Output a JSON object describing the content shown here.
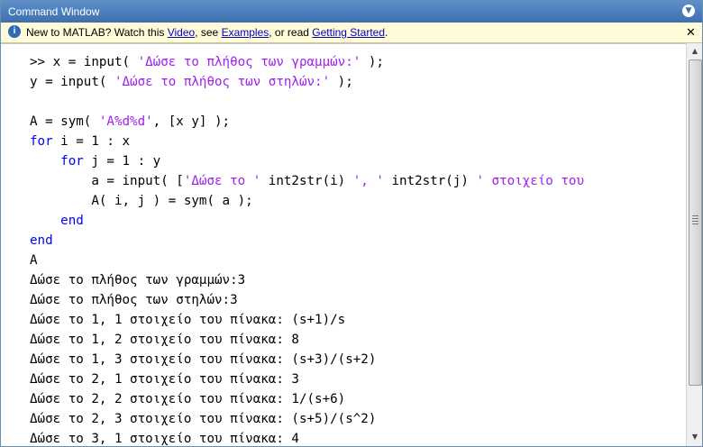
{
  "window": {
    "title": "Command Window",
    "menu_icon": "chevron-down-icon"
  },
  "infobar": {
    "prefix": "New to MATLAB? Watch this ",
    "video_link": "Video",
    "mid1": ", see ",
    "examples_link": "Examples",
    "mid2": ", or read ",
    "getting_started_link": "Getting Started",
    "suffix": ".",
    "close_label": "✕",
    "icon_label": "i"
  },
  "console": {
    "lines": [
      [
        {
          "t": ">> x = input( ",
          "c": "plain"
        },
        {
          "t": "'Δώσε το πλήθος των γραμμών:'",
          "c": "str"
        },
        {
          "t": " );",
          "c": "plain"
        }
      ],
      [
        {
          "t": "y = input( ",
          "c": "plain"
        },
        {
          "t": "'Δώσε το πλήθος των στηλών:'",
          "c": "str"
        },
        {
          "t": " );",
          "c": "plain"
        }
      ],
      [],
      [
        {
          "t": "A = sym( ",
          "c": "plain"
        },
        {
          "t": "'A%d%d'",
          "c": "str"
        },
        {
          "t": ", [x y] );",
          "c": "plain"
        }
      ],
      [
        {
          "t": "for",
          "c": "kw"
        },
        {
          "t": " i = 1 : x",
          "c": "plain"
        }
      ],
      [
        {
          "t": "    ",
          "c": "plain"
        },
        {
          "t": "for",
          "c": "kw"
        },
        {
          "t": " j = 1 : y",
          "c": "plain"
        }
      ],
      [
        {
          "t": "        a = input( [",
          "c": "plain"
        },
        {
          "t": "'Δώσε το '",
          "c": "str"
        },
        {
          "t": " int2str(i) ",
          "c": "plain"
        },
        {
          "t": "', '",
          "c": "str"
        },
        {
          "t": " int2str(j) ",
          "c": "plain"
        },
        {
          "t": "' στοιχείο του",
          "c": "str"
        }
      ],
      [
        {
          "t": "        A( i, j ) = sym( a );",
          "c": "plain"
        }
      ],
      [
        {
          "t": "    ",
          "c": "plain"
        },
        {
          "t": "end",
          "c": "kw"
        }
      ],
      [
        {
          "t": "end",
          "c": "kw"
        }
      ],
      [
        {
          "t": "A",
          "c": "plain"
        }
      ],
      [
        {
          "t": "Δώσε το πλήθος των γραμμών:3",
          "c": "plain"
        }
      ],
      [
        {
          "t": "Δώσε το πλήθος των στηλών:3",
          "c": "plain"
        }
      ],
      [
        {
          "t": "Δώσε το 1, 1 στοιχείο του πίνακα: (s+1)/s",
          "c": "plain"
        }
      ],
      [
        {
          "t": "Δώσε το 1, 2 στοιχείο του πίνακα: 8",
          "c": "plain"
        }
      ],
      [
        {
          "t": "Δώσε το 1, 3 στοιχείο του πίνακα: (s+3)/(s+2)",
          "c": "plain"
        }
      ],
      [
        {
          "t": "Δώσε το 2, 1 στοιχείο του πίνακα: 3",
          "c": "plain"
        }
      ],
      [
        {
          "t": "Δώσε το 2, 2 στοιχείο του πίνακα: 1/(s+6)",
          "c": "plain"
        }
      ],
      [
        {
          "t": "Δώσε το 2, 3 στοιχείο του πίνακα: (s+5)/(s^2)",
          "c": "plain"
        }
      ],
      [
        {
          "t": "Δώσε το 3, 1 στοιχείο του πίνακα: 4",
          "c": "plain"
        }
      ]
    ]
  },
  "colors": {
    "keyword": "#0000ff",
    "string": "#a020f0",
    "title_bar": "#4f7fbf",
    "infobar_bg": "#fffbd8"
  }
}
